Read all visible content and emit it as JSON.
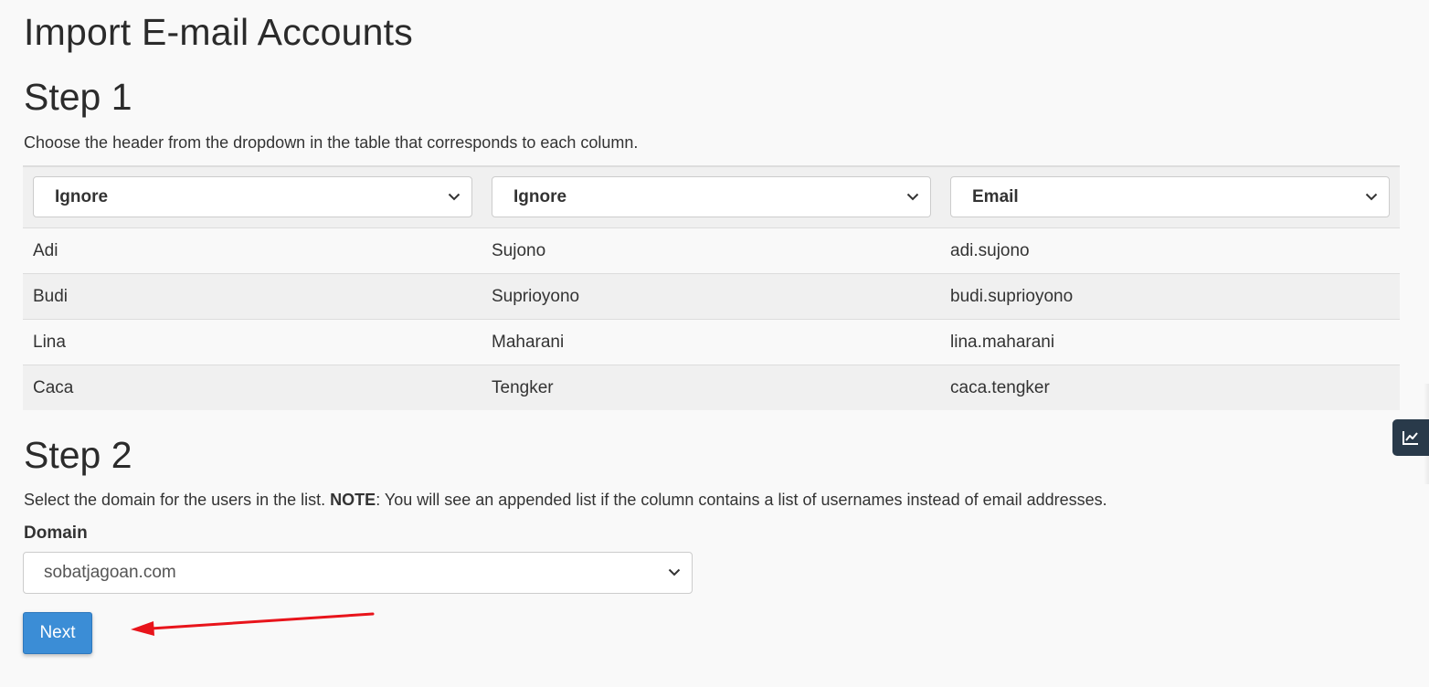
{
  "page": {
    "title": "Import E-mail Accounts"
  },
  "step1": {
    "title": "Step 1",
    "description": "Choose the header from the dropdown in the table that corresponds to each column.",
    "column_selects": [
      {
        "selected": "Ignore"
      },
      {
        "selected": "Ignore"
      },
      {
        "selected": "Email"
      }
    ],
    "rows": [
      [
        "Adi",
        "Sujono",
        "adi.sujono"
      ],
      [
        "Budi",
        "Suprioyono",
        "budi.suprioyono"
      ],
      [
        "Lina",
        "Maharani",
        "lina.maharani"
      ],
      [
        "Caca",
        "Tengker",
        "caca.tengker"
      ]
    ]
  },
  "step2": {
    "title": "Step 2",
    "description_start": "Select the domain for the users in the list. ",
    "note_label": "NOTE",
    "description_end": ": You will see an appended list if the column contains a list of usernames instead of email addresses.",
    "domain_label": "Domain",
    "domain_selected": "sobatjagoan.com",
    "next_label": "Next"
  },
  "icons": {
    "column_select_chevron": "chevron-down-icon",
    "domain_select_chevron": "chevron-down-icon",
    "side_widget": "line-chart-icon",
    "annotation": "red-arrow-icon"
  },
  "colors": {
    "primary_button": "#3b8dd6",
    "annotation_arrow": "#e8141b",
    "side_widget_bg": "#293a4a"
  }
}
